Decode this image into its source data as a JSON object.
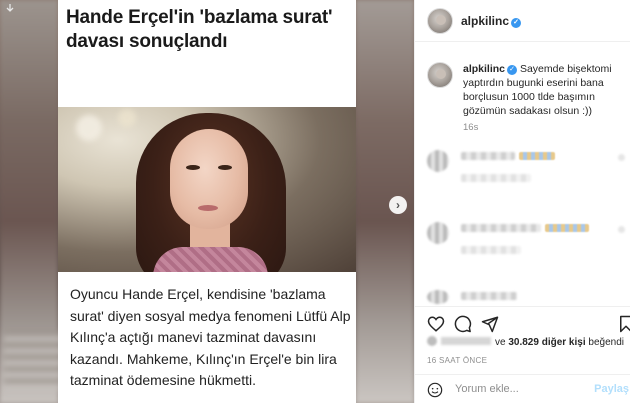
{
  "article": {
    "headline": "Hande Erçel'in 'bazlama surat' davası sonuçlandı",
    "body": "Oyuncu Hande Erçel, kendisine 'bazlama surat' diyen sosyal medya fenomeni Lütfü Alp Kılınç'a açtığı  manevi tazminat davasını kazandı. Mahkeme, Kılınç'ın Erçel'e bin lira tazminat ödemesine hükmetti."
  },
  "header": {
    "username": "alpkilinc",
    "verified": "✓"
  },
  "caption": {
    "username": "alpkilinc",
    "text": "Sayemde bişektomi yaptırdın bugunki eserini bana borçlusun 1000 tlde başımın gözümün sadakası olsun :))",
    "time": "16s"
  },
  "likes": {
    "text_prefix": "ve",
    "count": "30.829 diğer kişi",
    "text_suffix": "beğendi"
  },
  "post_time": "16 SAAT ÖNCE",
  "comment_box": {
    "placeholder": "Yorum ekle...",
    "post_label": "Paylaş"
  },
  "icons": {
    "download": "download-icon",
    "next": "chevron-right-icon",
    "heart": "heart-icon",
    "comment": "comment-icon",
    "share": "share-icon",
    "bookmark": "bookmark-icon",
    "emoji": "emoji-icon"
  },
  "colors": {
    "verified": "#3897f0",
    "post_button": "#b2dffc",
    "muted": "#8e8e8e"
  }
}
